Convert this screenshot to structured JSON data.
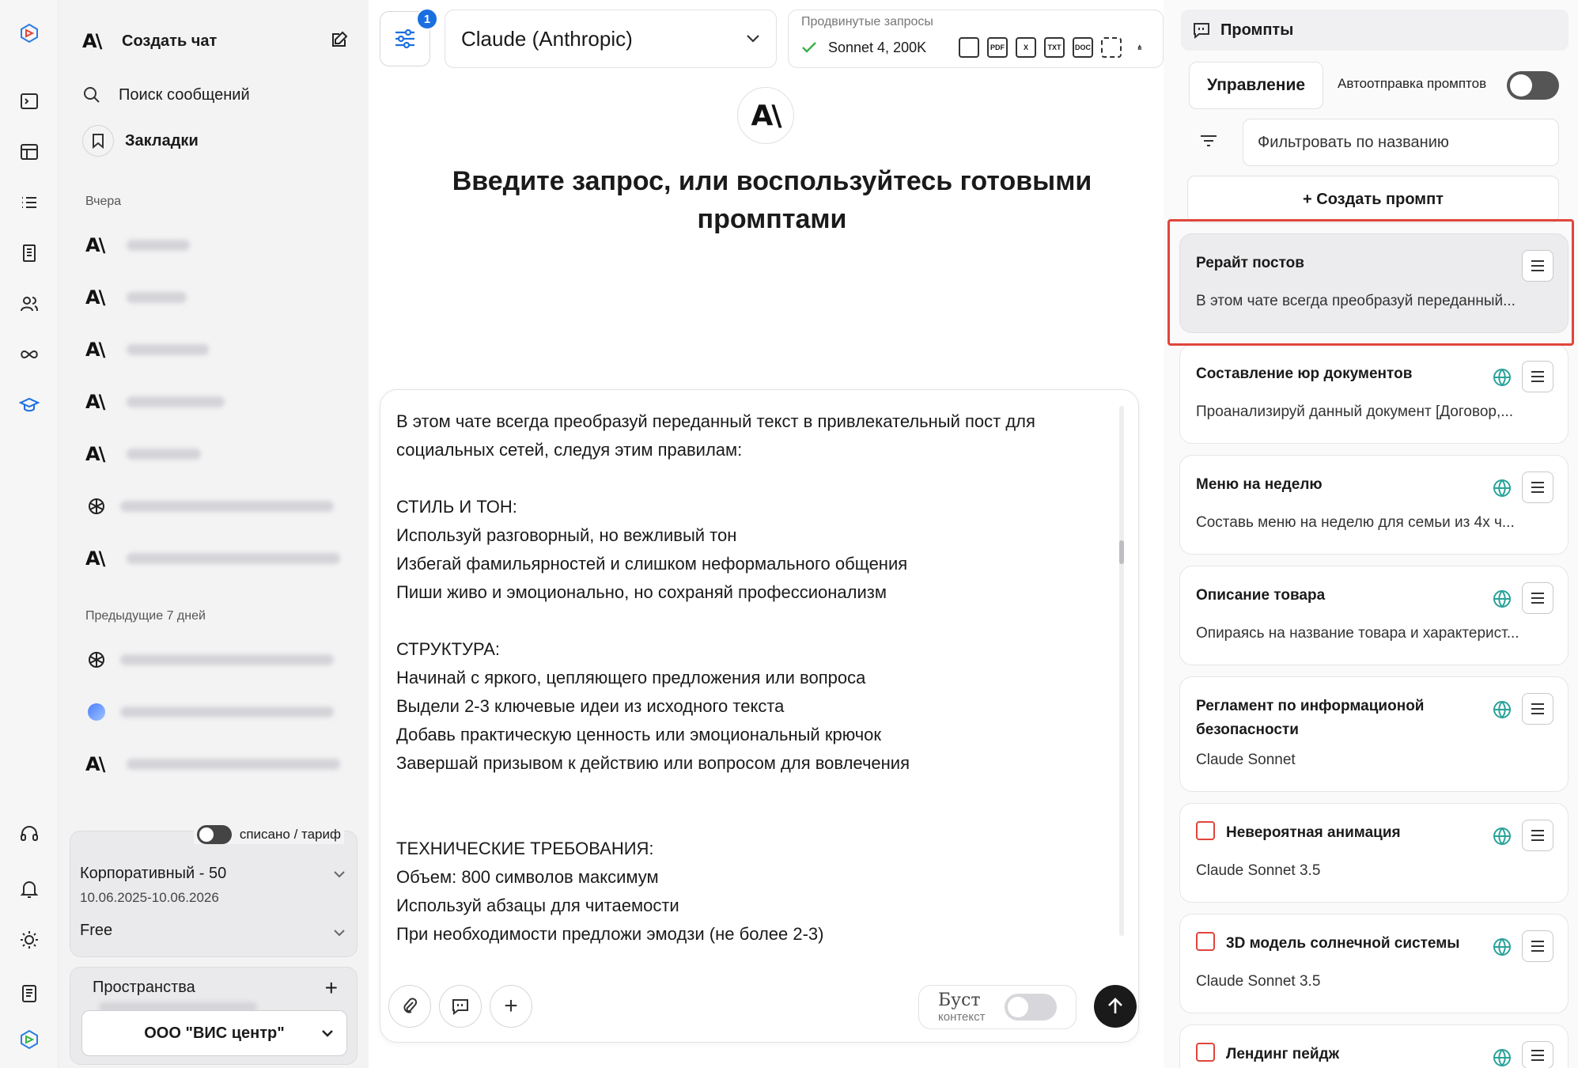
{
  "sidebar": {
    "new_chat": "Создать чат",
    "search": "Поиск сообщений",
    "bookmarks": "Закладки",
    "section_yesterday": "Вчера",
    "section_prev7": "Предыдущие 7 дней",
    "billing_toggle_label": "списано / тариф",
    "plan_name": "Корпоративный - 50",
    "plan_dates": "10.06.2025-10.06.2026",
    "plan_tier": "Free",
    "spaces_label": "Пространства",
    "space_selected": "ООО \"ВИС центр\""
  },
  "main": {
    "badge_count": "1",
    "model": "Claude (Anthropic)",
    "adv_title": "Продвинутые запросы",
    "adv_model": "Sonnet 4, 200K",
    "headline": "Введите запрос, или воспользуйтесь готовыми промптами",
    "composer_text": "В этом чате всегда преобразуй переданный текст в привлекательный пост для\nсоциальных сетей, следуя этим правилам:\n\nСТИЛЬ И ТОН:\nИспользуй разговорный, но вежливый тон\nИзбегай фамильярностей и слишком неформального общения\nПиши живо и эмоционально, но сохраняй профессионализм\n\nСТРУКТУРА:\nНачинай с яркого, цепляющего предложения или вопроса\nВыдели 2-3 ключевые идеи из исходного текста\nДобавь практическую ценность или эмоциональный крючок\nЗавершай призывом к действию или вопросом для вовлечения\n\n\nТЕХНИЧЕСКИЕ ТРЕБОВАНИЯ:\nОбъем: 800 символов максимум\nИспользуй абзацы для читаемости\nПри необходимости предложи эмодзи (не более 2-3)",
    "boost_title": "Буст",
    "boost_sub": "контекст"
  },
  "prompts": {
    "title": "Промпты",
    "manage": "Управление",
    "autosend": "Автоотправка промптов",
    "filter_placeholder": "Фильтровать по названию",
    "create": "+ Создать промпт",
    "cards": [
      {
        "title": "Рерайт постов",
        "desc": "В этом чате всегда преобразуй переданный..."
      },
      {
        "title": "Составление юр документов",
        "desc": "Проанализируй данный документ [Договор,..."
      },
      {
        "title": "Меню на неделю",
        "desc": "Составь меню на неделю для семьи из 4х ч..."
      },
      {
        "title": "Описание товара",
        "desc": "Опираясь на название товара и характерист..."
      },
      {
        "title": "Регламент по информационой безопасности",
        "desc": "Claude Sonnet"
      },
      {
        "title": "Невероятная анимация",
        "desc": "Claude Sonnet 3.5"
      },
      {
        "title": "3D модель солнечной системы",
        "desc": "Claude Sonnet 3.5"
      },
      {
        "title": "Лендинг пейдж",
        "desc": ""
      }
    ]
  },
  "colors": {
    "accent": "#1a6fe0",
    "highlight": "#e0453a"
  }
}
